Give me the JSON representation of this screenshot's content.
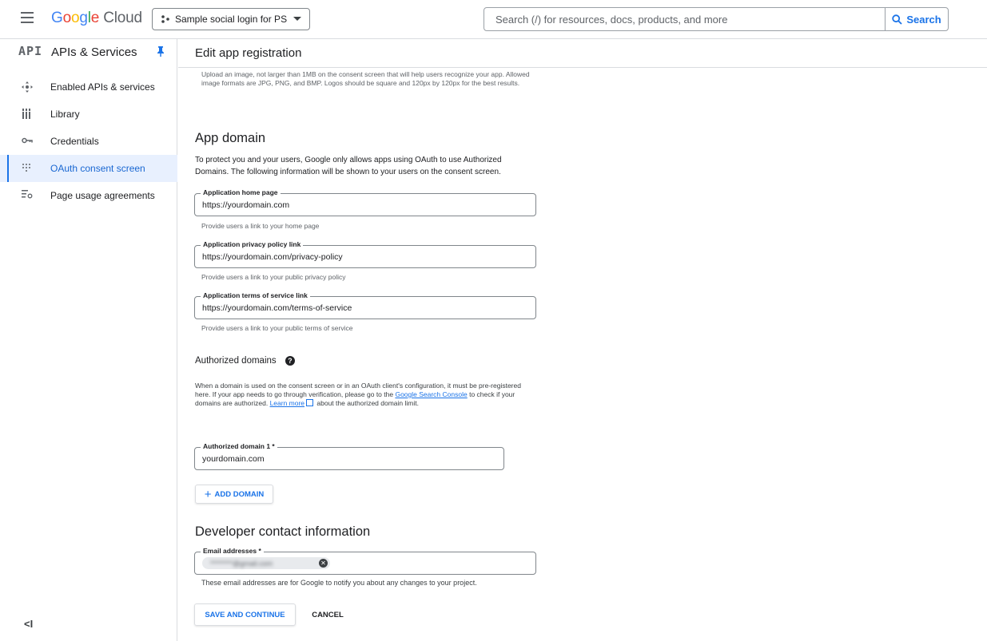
{
  "header": {
    "logo": {
      "g1": "G",
      "g2": "o",
      "g3": "o",
      "g4": "g",
      "g5": "l",
      "g6": "e",
      "cloud": " Cloud"
    },
    "project": "Sample social login for PS",
    "search_placeholder": "Search (/) for resources, docs, products, and more",
    "search_button": "Search"
  },
  "sidebar": {
    "logo_text": "API",
    "title": "APIs & Services",
    "items": [
      {
        "label": "Enabled APIs & services",
        "icon": "enabled-apis-icon",
        "active": false
      },
      {
        "label": "Library",
        "icon": "library-icon",
        "active": false
      },
      {
        "label": "Credentials",
        "icon": "key-icon",
        "active": false
      },
      {
        "label": "OAuth consent screen",
        "icon": "consent-icon",
        "active": true
      },
      {
        "label": "Page usage agreements",
        "icon": "agreements-icon",
        "active": false
      }
    ],
    "collapse": "<I"
  },
  "page": {
    "title": "Edit app registration"
  },
  "logo_section": {
    "help_text": "Upload an image, not larger than 1MB on the consent screen that will help users recognize your app. Allowed image formats are JPG, PNG, and BMP. Logos should be square and 120px by 120px for the best results."
  },
  "app_domain": {
    "heading": "App domain",
    "description": "To protect you and your users, Google only allows apps using OAuth to use Authorized Domains. The following information will be shown to your users on the consent screen.",
    "fields": [
      {
        "label": "Application home page",
        "value": "https://yourdomain.com",
        "hint": "Provide users a link to your home page"
      },
      {
        "label": "Application privacy policy link",
        "value": "https://yourdomain.com/privacy-policy",
        "hint": "Provide users a link to your public privacy policy"
      },
      {
        "label": "Application terms of service link",
        "value": "https://yourdomain.com/terms-of-service",
        "hint": "Provide users a link to your public terms of service"
      }
    ]
  },
  "authorized_domains": {
    "heading": "Authorized domains",
    "help_icon": "?",
    "text_1": "When a domain is used on the consent screen or in an OAuth client's configuration, it must be pre-registered here. If your app needs to go through verification, please go to the ",
    "link_console": "Google Search Console",
    "text_2": " to check if your domains are authorized. ",
    "link_learn": "Learn more",
    "text_3": " about the authorized domain limit.",
    "domain_label": "Authorized domain 1 *",
    "domain_value": "yourdomain.com",
    "add_button": "ADD DOMAIN",
    "add_icon": "+"
  },
  "developer_contact": {
    "heading": "Developer contact information",
    "email_label": "Email addresses *",
    "email_chip": "********@gmail.com",
    "email_hint": "These email addresses are for Google to notify you about any changes to your project."
  },
  "actions": {
    "save": "SAVE AND CONTINUE",
    "cancel": "CANCEL"
  }
}
